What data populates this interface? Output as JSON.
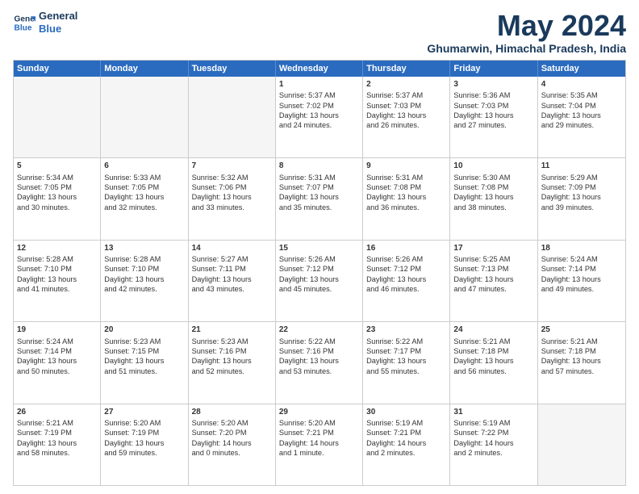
{
  "logo": {
    "line1": "General",
    "line2": "Blue"
  },
  "title": "May 2024",
  "location": "Ghumarwin, Himachal Pradesh, India",
  "weekdays": [
    "Sunday",
    "Monday",
    "Tuesday",
    "Wednesday",
    "Thursday",
    "Friday",
    "Saturday"
  ],
  "rows": [
    [
      {
        "day": "",
        "content": ""
      },
      {
        "day": "",
        "content": ""
      },
      {
        "day": "",
        "content": ""
      },
      {
        "day": "1",
        "content": "Sunrise: 5:37 AM\nSunset: 7:02 PM\nDaylight: 13 hours\nand 24 minutes."
      },
      {
        "day": "2",
        "content": "Sunrise: 5:37 AM\nSunset: 7:03 PM\nDaylight: 13 hours\nand 26 minutes."
      },
      {
        "day": "3",
        "content": "Sunrise: 5:36 AM\nSunset: 7:03 PM\nDaylight: 13 hours\nand 27 minutes."
      },
      {
        "day": "4",
        "content": "Sunrise: 5:35 AM\nSunset: 7:04 PM\nDaylight: 13 hours\nand 29 minutes."
      }
    ],
    [
      {
        "day": "5",
        "content": "Sunrise: 5:34 AM\nSunset: 7:05 PM\nDaylight: 13 hours\nand 30 minutes."
      },
      {
        "day": "6",
        "content": "Sunrise: 5:33 AM\nSunset: 7:05 PM\nDaylight: 13 hours\nand 32 minutes."
      },
      {
        "day": "7",
        "content": "Sunrise: 5:32 AM\nSunset: 7:06 PM\nDaylight: 13 hours\nand 33 minutes."
      },
      {
        "day": "8",
        "content": "Sunrise: 5:31 AM\nSunset: 7:07 PM\nDaylight: 13 hours\nand 35 minutes."
      },
      {
        "day": "9",
        "content": "Sunrise: 5:31 AM\nSunset: 7:08 PM\nDaylight: 13 hours\nand 36 minutes."
      },
      {
        "day": "10",
        "content": "Sunrise: 5:30 AM\nSunset: 7:08 PM\nDaylight: 13 hours\nand 38 minutes."
      },
      {
        "day": "11",
        "content": "Sunrise: 5:29 AM\nSunset: 7:09 PM\nDaylight: 13 hours\nand 39 minutes."
      }
    ],
    [
      {
        "day": "12",
        "content": "Sunrise: 5:28 AM\nSunset: 7:10 PM\nDaylight: 13 hours\nand 41 minutes."
      },
      {
        "day": "13",
        "content": "Sunrise: 5:28 AM\nSunset: 7:10 PM\nDaylight: 13 hours\nand 42 minutes."
      },
      {
        "day": "14",
        "content": "Sunrise: 5:27 AM\nSunset: 7:11 PM\nDaylight: 13 hours\nand 43 minutes."
      },
      {
        "day": "15",
        "content": "Sunrise: 5:26 AM\nSunset: 7:12 PM\nDaylight: 13 hours\nand 45 minutes."
      },
      {
        "day": "16",
        "content": "Sunrise: 5:26 AM\nSunset: 7:12 PM\nDaylight: 13 hours\nand 46 minutes."
      },
      {
        "day": "17",
        "content": "Sunrise: 5:25 AM\nSunset: 7:13 PM\nDaylight: 13 hours\nand 47 minutes."
      },
      {
        "day": "18",
        "content": "Sunrise: 5:24 AM\nSunset: 7:14 PM\nDaylight: 13 hours\nand 49 minutes."
      }
    ],
    [
      {
        "day": "19",
        "content": "Sunrise: 5:24 AM\nSunset: 7:14 PM\nDaylight: 13 hours\nand 50 minutes."
      },
      {
        "day": "20",
        "content": "Sunrise: 5:23 AM\nSunset: 7:15 PM\nDaylight: 13 hours\nand 51 minutes."
      },
      {
        "day": "21",
        "content": "Sunrise: 5:23 AM\nSunset: 7:16 PM\nDaylight: 13 hours\nand 52 minutes."
      },
      {
        "day": "22",
        "content": "Sunrise: 5:22 AM\nSunset: 7:16 PM\nDaylight: 13 hours\nand 53 minutes."
      },
      {
        "day": "23",
        "content": "Sunrise: 5:22 AM\nSunset: 7:17 PM\nDaylight: 13 hours\nand 55 minutes."
      },
      {
        "day": "24",
        "content": "Sunrise: 5:21 AM\nSunset: 7:18 PM\nDaylight: 13 hours\nand 56 minutes."
      },
      {
        "day": "25",
        "content": "Sunrise: 5:21 AM\nSunset: 7:18 PM\nDaylight: 13 hours\nand 57 minutes."
      }
    ],
    [
      {
        "day": "26",
        "content": "Sunrise: 5:21 AM\nSunset: 7:19 PM\nDaylight: 13 hours\nand 58 minutes."
      },
      {
        "day": "27",
        "content": "Sunrise: 5:20 AM\nSunset: 7:19 PM\nDaylight: 13 hours\nand 59 minutes."
      },
      {
        "day": "28",
        "content": "Sunrise: 5:20 AM\nSunset: 7:20 PM\nDaylight: 14 hours\nand 0 minutes."
      },
      {
        "day": "29",
        "content": "Sunrise: 5:20 AM\nSunset: 7:21 PM\nDaylight: 14 hours\nand 1 minute."
      },
      {
        "day": "30",
        "content": "Sunrise: 5:19 AM\nSunset: 7:21 PM\nDaylight: 14 hours\nand 2 minutes."
      },
      {
        "day": "31",
        "content": "Sunrise: 5:19 AM\nSunset: 7:22 PM\nDaylight: 14 hours\nand 2 minutes."
      },
      {
        "day": "",
        "content": ""
      }
    ]
  ]
}
